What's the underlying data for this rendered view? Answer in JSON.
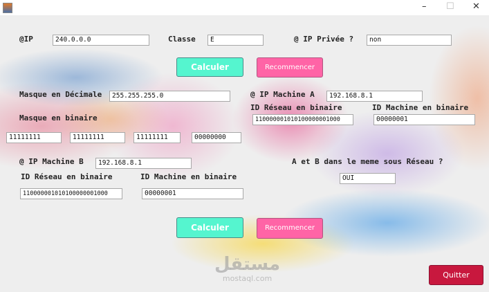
{
  "window": {
    "minimize": "–",
    "maximize": "☐",
    "close": "✕"
  },
  "ip": {
    "label": "@IP",
    "value": "240.0.0.0"
  },
  "classe": {
    "label": "Classe",
    "value": "E"
  },
  "prive": {
    "label": "@ IP Privée ?",
    "value": "non"
  },
  "buttons": {
    "calculer": "Calculer",
    "recommencer": "Recommencer",
    "quitter": "Quitter"
  },
  "masque": {
    "dec_label": "Masque en Décimale",
    "dec_value": "255.255.255.0",
    "bin_label": "Masque en binaire",
    "bin_values": [
      "11111111",
      "11111111",
      "11111111",
      "00000000"
    ]
  },
  "machine_a": {
    "label": "@ IP Machine A",
    "value": "192.168.8.1",
    "reseau_label": "ID Réseau en binaire",
    "reseau_value": "110000001010100000001000",
    "machine_label": "ID Machine en binaire",
    "machine_value": "00000001"
  },
  "machine_b": {
    "label": "@ IP Machine B",
    "value": "192.168.8.1",
    "reseau_label": "ID Réseau en binaire",
    "reseau_value": "110000001010100000001000",
    "machine_label": "ID Machine en binaire",
    "machine_value": "00000001"
  },
  "meme_reseau": {
    "label": "A et B dans le meme sous Réseau ?",
    "value": "OUI"
  },
  "watermark": {
    "arabic": "مستقل",
    "latin": "mostaql.com"
  }
}
